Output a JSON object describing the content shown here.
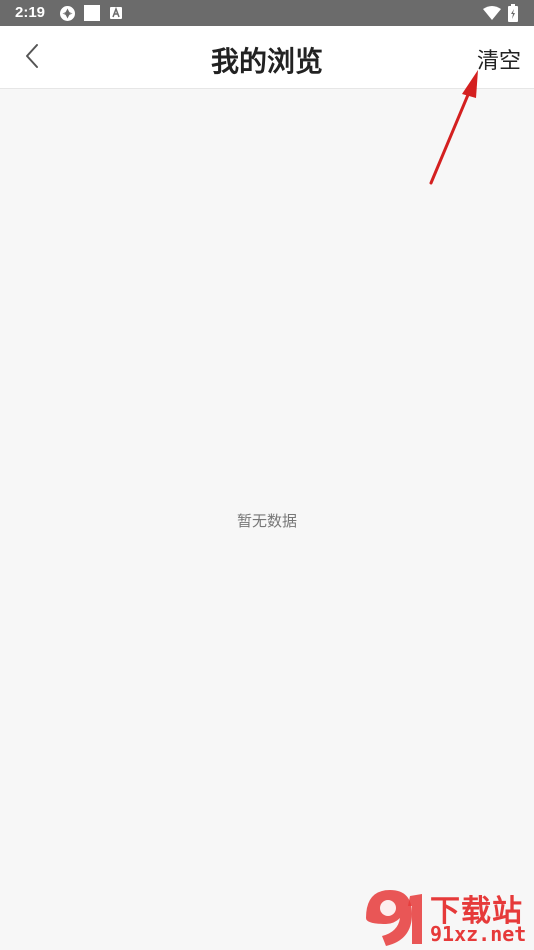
{
  "status_bar": {
    "time": "2:19",
    "icons": [
      "shutter-icon",
      "square-icon",
      "a-badge-icon",
      "wifi-icon",
      "battery-icon"
    ],
    "background_color": "#6b6b6b"
  },
  "header": {
    "title": "我的浏览",
    "clear_label": "清空",
    "back_icon": "chevron-left-icon"
  },
  "content": {
    "empty_message": "暂无数据"
  },
  "annotation": {
    "color": "#d42020"
  },
  "watermark": {
    "title": "下载站",
    "url": "91xz.net",
    "color": "#e63a3a"
  }
}
